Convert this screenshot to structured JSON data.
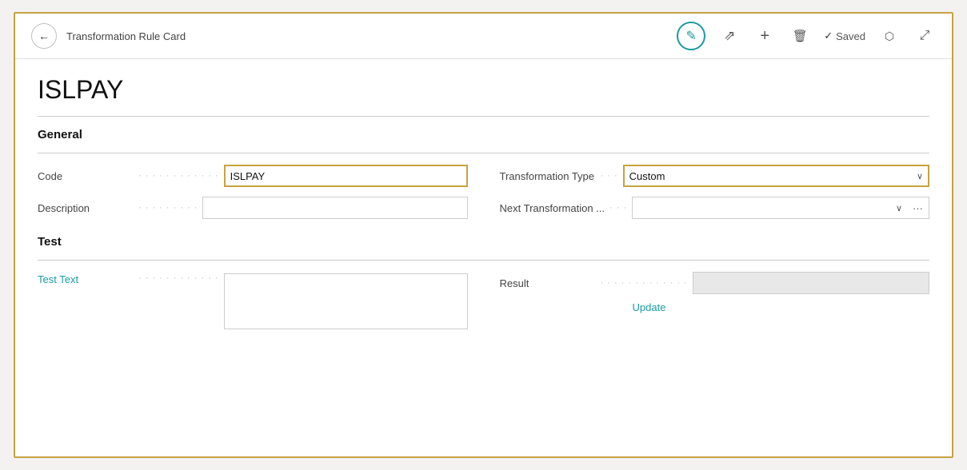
{
  "header": {
    "back_label": "←",
    "title": "Transformation Rule Card",
    "saved_label": "Saved",
    "saved_check": "✓"
  },
  "page": {
    "title": "ISLPAY"
  },
  "general": {
    "section_label": "General",
    "code_label": "Code",
    "code_dots": "· · · · · · · · · · · ·",
    "code_value": "ISLPAY",
    "description_label": "Description",
    "description_dots": "· · · · · · · · ·",
    "description_value": "",
    "transformation_type_label": "Transformation Type",
    "transformation_type_dots": "· · ·",
    "transformation_type_value": "Custom",
    "next_transformation_label": "Next Transformation ...",
    "next_transformation_dots": "· · ·",
    "next_transformation_value": ""
  },
  "test": {
    "section_label": "Test",
    "test_text_label": "Test Text",
    "test_text_dots": "· · · · · · · · · · · ·",
    "test_text_value": "",
    "result_label": "Result",
    "result_dots": "· · · · · · · · · · · · ·",
    "result_value": "",
    "update_label": "Update"
  },
  "icons": {
    "edit": "✎",
    "share": "↗",
    "add": "+",
    "delete": "🗑",
    "external": "⧉",
    "expand": "⤢",
    "chevron_down": "∨",
    "ellipsis": "···"
  }
}
